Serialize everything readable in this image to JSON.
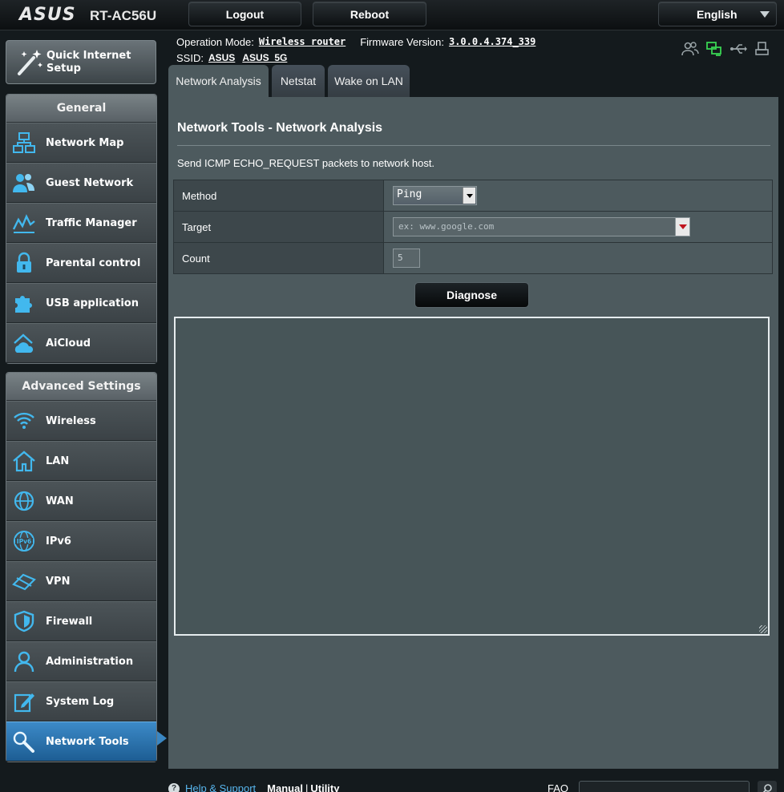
{
  "header": {
    "brand": "ASUS",
    "model": "RT-AC56U",
    "logout_label": "Logout",
    "reboot_label": "Reboot",
    "language": "English"
  },
  "info": {
    "op_mode_label": "Operation Mode:",
    "op_mode_value": "Wireless router",
    "firmware_label": "Firmware Version:",
    "firmware_value": "3.0.0.4.374_339",
    "ssid_label": "SSID:",
    "ssid_1": "ASUS",
    "ssid_2": "ASUS_5G"
  },
  "sidebar": {
    "quick_setup": "Quick Internet Setup",
    "general_title": "General",
    "general_items": [
      {
        "label": "Network Map"
      },
      {
        "label": "Guest Network"
      },
      {
        "label": "Traffic Manager"
      },
      {
        "label": "Parental control"
      },
      {
        "label": "USB application"
      },
      {
        "label": "AiCloud"
      }
    ],
    "advanced_title": "Advanced Settings",
    "advanced_items": [
      {
        "label": "Wireless"
      },
      {
        "label": "LAN"
      },
      {
        "label": "WAN"
      },
      {
        "label": "IPv6"
      },
      {
        "label": "VPN"
      },
      {
        "label": "Firewall"
      },
      {
        "label": "Administration"
      },
      {
        "label": "System Log"
      },
      {
        "label": "Network Tools"
      }
    ],
    "active_item": "Network Tools"
  },
  "tabs": [
    {
      "label": "Network Analysis",
      "active": true
    },
    {
      "label": "Netstat",
      "active": false
    },
    {
      "label": "Wake on LAN",
      "active": false
    }
  ],
  "main": {
    "title": "Network Tools - Network Analysis",
    "description": "Send ICMP ECHO_REQUEST packets to network host.",
    "method_label": "Method",
    "method_value": "Ping",
    "target_label": "Target",
    "target_placeholder": "ex: www.google.com",
    "count_label": "Count",
    "count_value": "5",
    "diagnose_label": "Diagnose",
    "output_text": ""
  },
  "footer": {
    "help_label": "Help & Support",
    "manual_label": "Manual",
    "separator": "|",
    "utility_label": "Utility",
    "faq_label": "FAQ"
  },
  "colors": {
    "accent_active": "#2f78b8",
    "icon_blue": "#42b8ee",
    "status_green": "#39d353",
    "panel_bg": "#4d5a5e"
  }
}
